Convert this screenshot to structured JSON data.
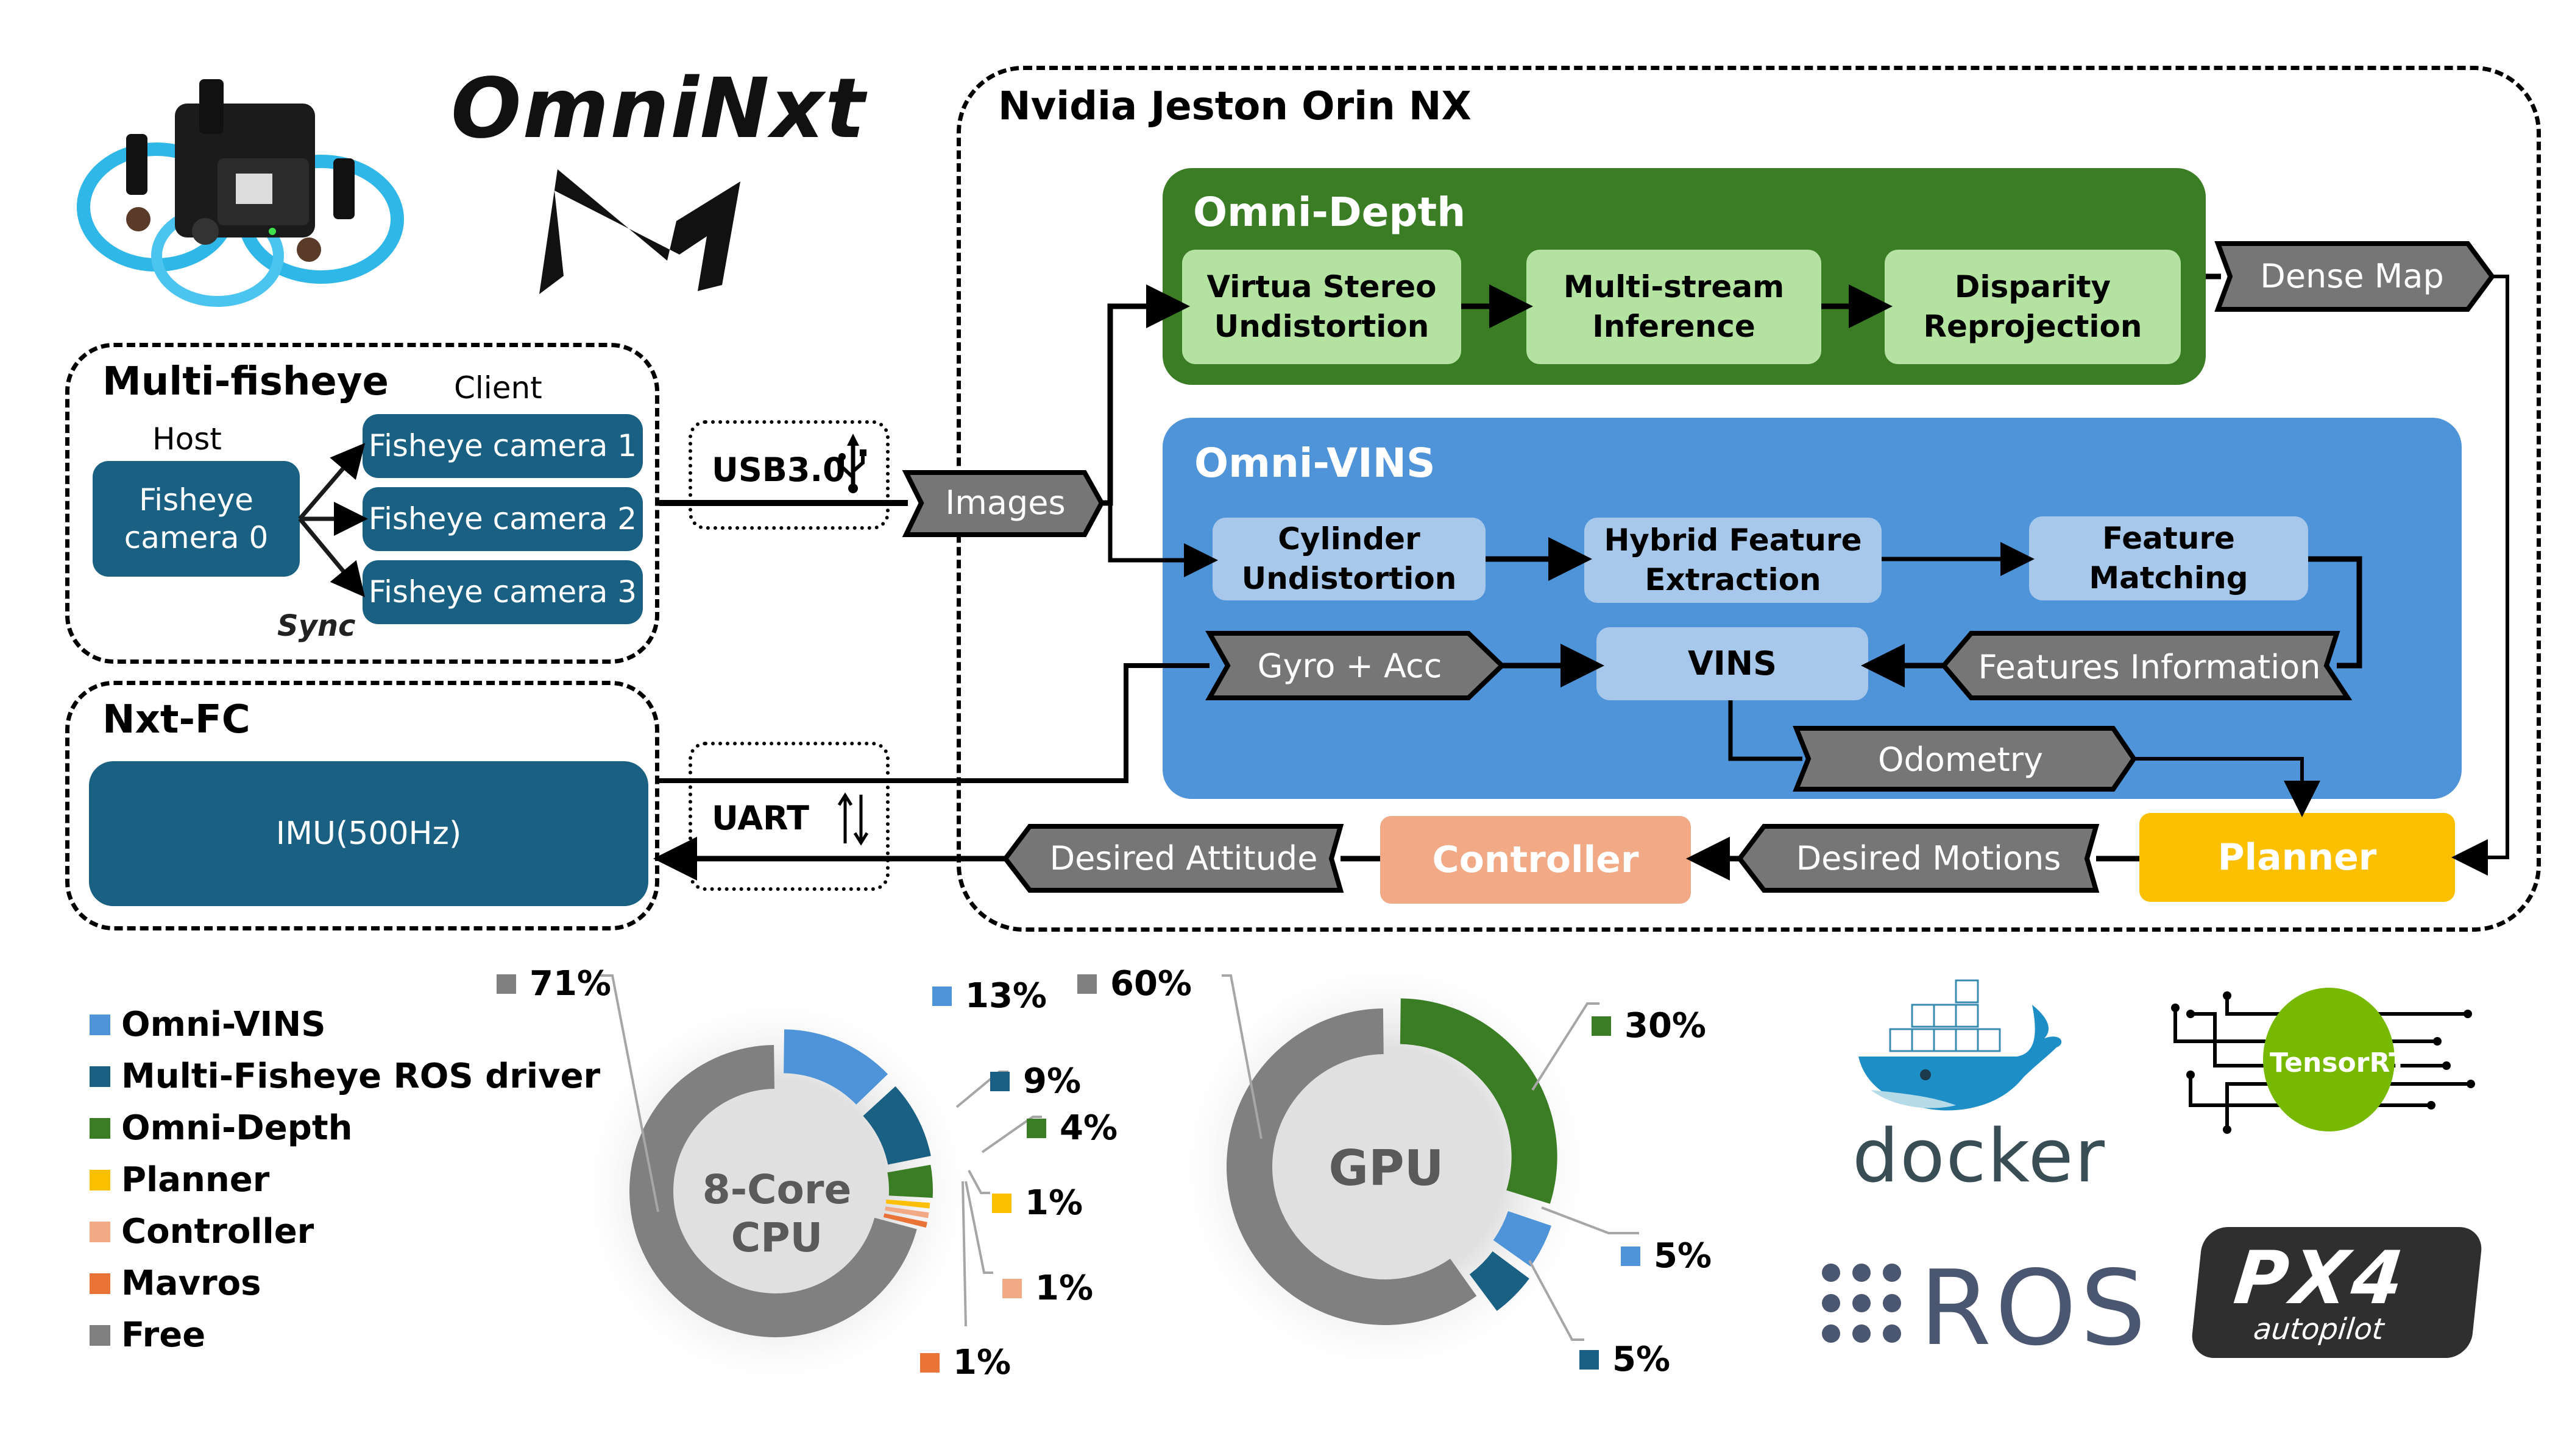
{
  "brand": {
    "title": "OmniNxt",
    "drone_image": "drone-photo",
    "logo_icon": "omninxt-logo-icon"
  },
  "multi_fisheye": {
    "title": "Multi-fisheye",
    "host_label": "Host",
    "client_label": "Client",
    "sync_label": "Sync",
    "host_camera": "Fisheye\ncamera 0",
    "client_cameras": [
      "Fisheye camera 1",
      "Fisheye camera 2",
      "Fisheye camera 3"
    ]
  },
  "nxt_fc": {
    "title": "Nxt-FC",
    "imu_label": "IMU(500Hz)"
  },
  "links": {
    "usb_label": "USB3.0",
    "uart_label": "UART"
  },
  "jetson": {
    "title": "Nvidia Jeston Orin NX",
    "images_tag": "Images",
    "dense_map_tag": "Dense Map",
    "omni_depth": {
      "title": "Omni-Depth",
      "steps": [
        "Virtua Stereo\nUndistortion",
        "Multi-stream\nInference",
        "Disparity\nReprojection"
      ]
    },
    "omni_vins": {
      "title": "Omni-VINS",
      "steps": [
        "Cylinder\nUndistortion",
        "Hybrid Feature\nExtraction",
        "Feature\nMatching"
      ],
      "vins_label": "VINS",
      "gyro_tag": "Gyro + Acc",
      "features_tag": "Features Information",
      "odometry_tag": "Odometry"
    },
    "planner_label": "Planner",
    "controller_label": "Controller",
    "desired_motions_tag": "Desired Motions",
    "desired_attitude_tag": "Desired Attitude"
  },
  "colors": {
    "omni_vins": "#4f94d8",
    "multi_fisheye_driver": "#1a6083",
    "omni_depth": "#3b7d25",
    "planner": "#fdc000",
    "controller": "#f1a986",
    "mavros": "#ea7337",
    "free": "#808080",
    "tag_gray": "#767676"
  },
  "legend": [
    {
      "label": "Omni-VINS",
      "color": "#4f94d8"
    },
    {
      "label": "Multi-Fisheye ROS driver",
      "color": "#1a6083"
    },
    {
      "label": "Omni-Depth",
      "color": "#3b7d25"
    },
    {
      "label": "Planner",
      "color": "#fdc000"
    },
    {
      "label": "Controller",
      "color": "#f1a986"
    },
    {
      "label": "Mavros",
      "color": "#ea7337"
    },
    {
      "label": "Free",
      "color": "#808080"
    }
  ],
  "chart_data": [
    {
      "type": "pie",
      "variant": "donut",
      "title": "8-Core CPU",
      "center_label": "8-Core\nCPU",
      "categories": [
        "Omni-VINS",
        "Multi-Fisheye ROS driver",
        "Omni-Depth",
        "Planner",
        "Controller",
        "Mavros",
        "Free"
      ],
      "values": [
        13,
        9,
        4,
        1,
        1,
        1,
        71
      ],
      "labels": [
        "13%",
        "9%",
        "4%",
        "1%",
        "1%",
        "1%",
        "71%"
      ],
      "colors": [
        "#4f94d8",
        "#1a6083",
        "#3b7d25",
        "#fdc000",
        "#f1a986",
        "#ea7337",
        "#808080"
      ],
      "legend": "left"
    },
    {
      "type": "pie",
      "variant": "donut",
      "title": "GPU",
      "center_label": "GPU",
      "categories": [
        "Omni-Depth",
        "Omni-VINS",
        "Multi-Fisheye ROS driver",
        "Free"
      ],
      "values": [
        30,
        5,
        5,
        60
      ],
      "labels": [
        "30%",
        "5%",
        "5%",
        "60%"
      ],
      "colors": [
        "#3b7d25",
        "#4f94d8",
        "#1a6083",
        "#808080"
      ],
      "legend": "left"
    }
  ],
  "tech_logos": {
    "docker": "docker",
    "tensorrt": "TensorRT",
    "ros": "ROS",
    "px4_main": "PX4",
    "px4_sub": "autopilot"
  }
}
